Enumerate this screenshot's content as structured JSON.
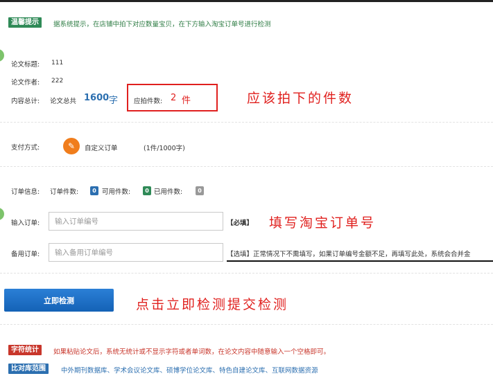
{
  "notice": {
    "tag": "温馨提示",
    "text": "据系统提示，在店铺中拍下对应数量宝贝，在下方输入淘宝订单号进行检测"
  },
  "paper": {
    "title_label": "论文标题:",
    "title_value": "111",
    "author_label": "论文作者:",
    "author_value": "222",
    "total_label": "内容总计:",
    "total_prefix": "论文总共",
    "total_count": "1600",
    "total_unit": "字",
    "pieces_label": "应拍件数:",
    "pieces_count": "2",
    "pieces_unit": "件"
  },
  "annotations": {
    "pieces_note": "应该拍下的件数",
    "order_note": "填写淘宝订单号",
    "submit_note": "点击立即检测提交检测"
  },
  "payment": {
    "label": "支付方式:",
    "option_name": "自定义订单",
    "option_rule": "(1件/1000字)"
  },
  "order_info": {
    "label": "订单信息:",
    "order_count_label": "订单件数:",
    "order_count": "0",
    "available_label": "可用件数:",
    "available_count": "0",
    "used_label": "已用件数:",
    "used_count": "0"
  },
  "order_input": {
    "label": "输入订单:",
    "placeholder": "输入订单编号",
    "required_note": "【必填】"
  },
  "backup_input": {
    "label": "备用订单:",
    "placeholder": "输入备用订单编号",
    "optional_note": "【选填】正常情况下不需填写，如果订单编号金额不足，再填写此处，系统会合并金"
  },
  "submit": {
    "label": "立即检测"
  },
  "footer": {
    "count_tag": "字符统计",
    "count_text": "如果粘贴论文后，系统无统计或不显示字符或者单词数，在论文内容中随意输入一个空格即可。",
    "db_tag": "比对库范围",
    "db_text": "中外期刊数据库、学术会议论文库、硕博学位论文库、特色自建论文库、互联网数据资源"
  },
  "colors": {
    "accent_blue": "#2c6fb0",
    "annotation_red": "#e0201e",
    "tag_green": "#2f8a57",
    "tag_red": "#c8362b"
  }
}
